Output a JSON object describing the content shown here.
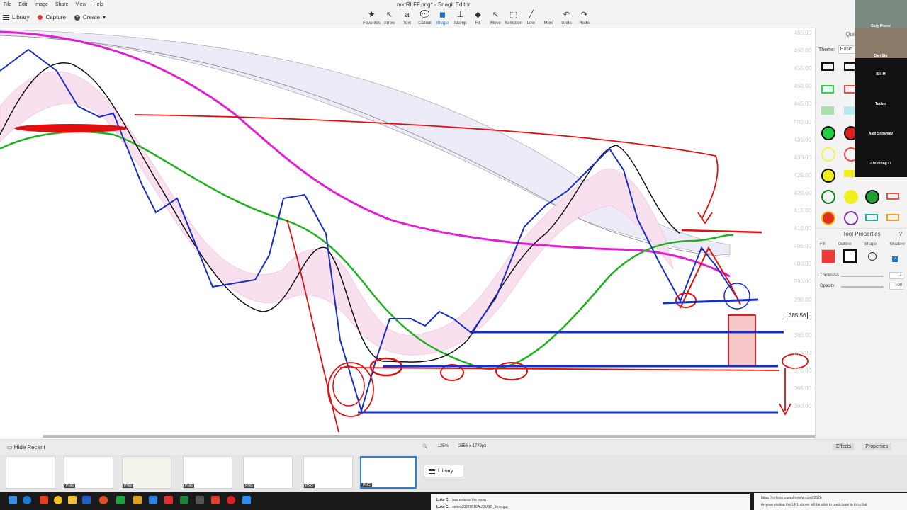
{
  "menu": {
    "items": [
      "File",
      "Edit",
      "Image",
      "Share",
      "View",
      "Help"
    ],
    "window_title": "mktRLFF.png* - Snagit Editor"
  },
  "toolbar_left": {
    "library": "Library",
    "capture": "Capture",
    "create": "Create"
  },
  "tools": [
    {
      "label": "Favorites",
      "icon": "star-icon",
      "glyph": "★"
    },
    {
      "label": "Arrow",
      "icon": "arrow-icon",
      "glyph": "↖"
    },
    {
      "label": "Text",
      "icon": "text-icon",
      "glyph": "a"
    },
    {
      "label": "Callout",
      "icon": "callout-icon",
      "glyph": "💬"
    },
    {
      "label": "Shape",
      "icon": "shape-icon",
      "glyph": "◼"
    },
    {
      "label": "Stamp",
      "icon": "stamp-icon",
      "glyph": "⊥"
    },
    {
      "label": "Fill",
      "icon": "fill-icon",
      "glyph": "◆"
    },
    {
      "label": "Move",
      "icon": "move-icon",
      "glyph": "↖"
    },
    {
      "label": "Selection",
      "icon": "selection-icon",
      "glyph": "⬚"
    },
    {
      "label": "Line",
      "icon": "line-icon",
      "glyph": "╱"
    },
    {
      "label": "More",
      "icon": "more-icon",
      "glyph": ""
    },
    {
      "label": "Undo",
      "icon": "undo-icon",
      "glyph": "↶"
    },
    {
      "label": "Redo",
      "icon": "redo-icon",
      "glyph": "↷"
    }
  ],
  "active_tool": "Shape",
  "price_axis": [
    "465.00",
    "460.00",
    "455.00",
    "450.00",
    "445.00",
    "440.00",
    "435.00",
    "430.00",
    "425.00",
    "420.00",
    "415.00",
    "410.00",
    "405.00",
    "400.00",
    "395.00",
    "390.00",
    "385.00",
    "380.00",
    "375.00",
    "370.00",
    "365.00",
    "360.00"
  ],
  "price_tag": "385.56",
  "right_panel": {
    "header": "Quick Styles",
    "theme_label": "Theme:",
    "theme_value": "Basic",
    "tool_properties": "Tool Properties",
    "props": [
      "Fill",
      "Outline",
      "Shape",
      "Shadow"
    ],
    "thickness_label": "Thickness",
    "thickness_value": "1",
    "opacity_label": "Opacity",
    "opacity_value": "100"
  },
  "participants": [
    "Gary Pierce",
    "Dan Stu",
    "Bill M",
    "Tucker",
    "Alex Shoshiev",
    "Chunlong Li"
  ],
  "bottom": {
    "hide_recent": "Hide Recent",
    "zoom": "125%",
    "dimensions": "2856 x 1779px",
    "effects": "Effects",
    "properties": "Properties",
    "library": "Library"
  },
  "thumb_badges": [
    "PNG",
    "PNG",
    "PNG",
    "PNG",
    "PNG",
    "PNG"
  ],
  "chat": {
    "line1_name": "Luke C.",
    "line1_text": "has entered the room",
    "line2_name": "Luke C.",
    "line2_text": "series20220916AUDUSD_5min.jpg"
  },
  "chat2": {
    "url": "https://tortoise.campfirenow.com/3f52b",
    "note": "Anyone visiting the URL above will be able to participate in this chat"
  },
  "colors": {
    "accent": "#1a73c8",
    "annotation_red": "#e01010",
    "annotation_blue": "#1530c8",
    "magenta_line": "#e020d0",
    "green_line": "#20b020"
  }
}
